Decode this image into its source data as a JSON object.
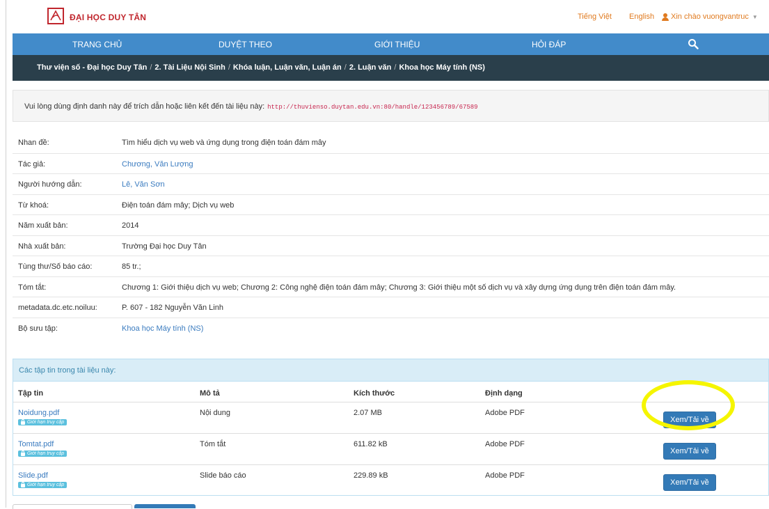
{
  "header": {
    "brand": "ĐẠI HỌC DUY TÂN",
    "lang_vi": "Tiếng Việt",
    "lang_en": "English",
    "user_greeting": "Xin chào vuongvantruc"
  },
  "nav": {
    "items": [
      "TRANG CHỦ",
      "DUYỆT THEO",
      "GIỚI THIỆU",
      "HỎI ĐÁP"
    ]
  },
  "breadcrumb": {
    "items": [
      "Thư viện số - Đại học Duy Tân",
      "2. Tài Liệu Nội Sinh",
      "Khóa luận, Luận văn, Luận án",
      "2. Luận văn",
      "Khoa học Máy tính (NS)"
    ]
  },
  "cite": {
    "text": "Vui lòng dùng định danh này để trích dẫn hoặc liên kết đến tài liệu này:",
    "url": "http://thuvienso.duytan.edu.vn:80/handle/123456789/67589"
  },
  "metadata": [
    {
      "label": "Nhan đề:",
      "value": "Tìm hiểu dịch vụ web và ứng dụng trong điện toán đám mây",
      "link": false
    },
    {
      "label": "Tác giả:",
      "value": "Chương, Văn Lượng",
      "link": true
    },
    {
      "label": "Người hướng dẫn:",
      "value": "Lê, Văn Sơn",
      "link": true
    },
    {
      "label": "Từ khoá:",
      "value": "Điện toán đám mây; Dịch vụ web",
      "link": false
    },
    {
      "label": "Năm xuất bản:",
      "value": "2014",
      "link": false
    },
    {
      "label": "Nhà xuất bản:",
      "value": "Trường Đại học Duy Tân",
      "link": false
    },
    {
      "label": "Tùng thư/Số báo cáo:",
      "value": "85 tr.;",
      "link": false
    },
    {
      "label": "Tóm tắt:",
      "value": "Chương 1: Giới thiệu dịch vụ web; Chương 2: Công nghệ điện toán đám mây; Chương 3: Giới thiệu một số dịch vụ và xây dựng ứng dụng trên điện toán đám mây.",
      "link": false
    },
    {
      "label": "metadata.dc.etc.noiluu:",
      "value": "P. 607 - 182 Nguyễn Văn Linh",
      "link": false
    },
    {
      "label": "Bộ sưu tập:",
      "value": "Khoa học Máy tính (NS)",
      "link": true
    }
  ],
  "files": {
    "panel_title": "Các tập tin trong tài liệu này:",
    "columns": [
      "Tập tin",
      "Mô tả",
      "Kích thước",
      "Định dạng"
    ],
    "restricted_badge": "Giới hạn truy cập",
    "button_label": "Xem/Tải về",
    "rows": [
      {
        "name": "Noidung.pdf",
        "desc": "Nội dung",
        "size": "2.07 MB",
        "format": "Adobe PDF"
      },
      {
        "name": "Tomtat.pdf",
        "desc": "Tóm tắt",
        "size": "611.82 kB",
        "format": "Adobe PDF"
      },
      {
        "name": "Slide.pdf",
        "desc": "Slide báo cáo",
        "size": "229.89 kB",
        "format": "Adobe PDF"
      }
    ]
  },
  "colors": {
    "brand_red": "#c0262d",
    "nav_blue": "#428bca",
    "breadcrumb_dark": "#2a3f4b",
    "highlight_yellow": "#f5f500"
  }
}
